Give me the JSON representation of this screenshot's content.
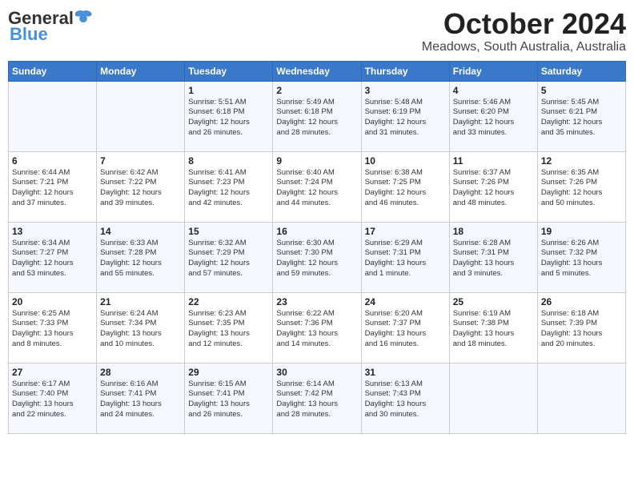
{
  "header": {
    "logo_general": "General",
    "logo_blue": "Blue",
    "month": "October 2024",
    "location": "Meadows, South Australia, Australia"
  },
  "weekdays": [
    "Sunday",
    "Monday",
    "Tuesday",
    "Wednesday",
    "Thursday",
    "Friday",
    "Saturday"
  ],
  "weeks": [
    [
      {
        "day": "",
        "info": ""
      },
      {
        "day": "",
        "info": ""
      },
      {
        "day": "1",
        "info": "Sunrise: 5:51 AM\nSunset: 6:18 PM\nDaylight: 12 hours\nand 26 minutes."
      },
      {
        "day": "2",
        "info": "Sunrise: 5:49 AM\nSunset: 6:18 PM\nDaylight: 12 hours\nand 28 minutes."
      },
      {
        "day": "3",
        "info": "Sunrise: 5:48 AM\nSunset: 6:19 PM\nDaylight: 12 hours\nand 31 minutes."
      },
      {
        "day": "4",
        "info": "Sunrise: 5:46 AM\nSunset: 6:20 PM\nDaylight: 12 hours\nand 33 minutes."
      },
      {
        "day": "5",
        "info": "Sunrise: 5:45 AM\nSunset: 6:21 PM\nDaylight: 12 hours\nand 35 minutes."
      }
    ],
    [
      {
        "day": "6",
        "info": "Sunrise: 6:44 AM\nSunset: 7:21 PM\nDaylight: 12 hours\nand 37 minutes."
      },
      {
        "day": "7",
        "info": "Sunrise: 6:42 AM\nSunset: 7:22 PM\nDaylight: 12 hours\nand 39 minutes."
      },
      {
        "day": "8",
        "info": "Sunrise: 6:41 AM\nSunset: 7:23 PM\nDaylight: 12 hours\nand 42 minutes."
      },
      {
        "day": "9",
        "info": "Sunrise: 6:40 AM\nSunset: 7:24 PM\nDaylight: 12 hours\nand 44 minutes."
      },
      {
        "day": "10",
        "info": "Sunrise: 6:38 AM\nSunset: 7:25 PM\nDaylight: 12 hours\nand 46 minutes."
      },
      {
        "day": "11",
        "info": "Sunrise: 6:37 AM\nSunset: 7:26 PM\nDaylight: 12 hours\nand 48 minutes."
      },
      {
        "day": "12",
        "info": "Sunrise: 6:35 AM\nSunset: 7:26 PM\nDaylight: 12 hours\nand 50 minutes."
      }
    ],
    [
      {
        "day": "13",
        "info": "Sunrise: 6:34 AM\nSunset: 7:27 PM\nDaylight: 12 hours\nand 53 minutes."
      },
      {
        "day": "14",
        "info": "Sunrise: 6:33 AM\nSunset: 7:28 PM\nDaylight: 12 hours\nand 55 minutes."
      },
      {
        "day": "15",
        "info": "Sunrise: 6:32 AM\nSunset: 7:29 PM\nDaylight: 12 hours\nand 57 minutes."
      },
      {
        "day": "16",
        "info": "Sunrise: 6:30 AM\nSunset: 7:30 PM\nDaylight: 12 hours\nand 59 minutes."
      },
      {
        "day": "17",
        "info": "Sunrise: 6:29 AM\nSunset: 7:31 PM\nDaylight: 13 hours\nand 1 minute."
      },
      {
        "day": "18",
        "info": "Sunrise: 6:28 AM\nSunset: 7:31 PM\nDaylight: 13 hours\nand 3 minutes."
      },
      {
        "day": "19",
        "info": "Sunrise: 6:26 AM\nSunset: 7:32 PM\nDaylight: 13 hours\nand 5 minutes."
      }
    ],
    [
      {
        "day": "20",
        "info": "Sunrise: 6:25 AM\nSunset: 7:33 PM\nDaylight: 13 hours\nand 8 minutes."
      },
      {
        "day": "21",
        "info": "Sunrise: 6:24 AM\nSunset: 7:34 PM\nDaylight: 13 hours\nand 10 minutes."
      },
      {
        "day": "22",
        "info": "Sunrise: 6:23 AM\nSunset: 7:35 PM\nDaylight: 13 hours\nand 12 minutes."
      },
      {
        "day": "23",
        "info": "Sunrise: 6:22 AM\nSunset: 7:36 PM\nDaylight: 13 hours\nand 14 minutes."
      },
      {
        "day": "24",
        "info": "Sunrise: 6:20 AM\nSunset: 7:37 PM\nDaylight: 13 hours\nand 16 minutes."
      },
      {
        "day": "25",
        "info": "Sunrise: 6:19 AM\nSunset: 7:38 PM\nDaylight: 13 hours\nand 18 minutes."
      },
      {
        "day": "26",
        "info": "Sunrise: 6:18 AM\nSunset: 7:39 PM\nDaylight: 13 hours\nand 20 minutes."
      }
    ],
    [
      {
        "day": "27",
        "info": "Sunrise: 6:17 AM\nSunset: 7:40 PM\nDaylight: 13 hours\nand 22 minutes."
      },
      {
        "day": "28",
        "info": "Sunrise: 6:16 AM\nSunset: 7:41 PM\nDaylight: 13 hours\nand 24 minutes."
      },
      {
        "day": "29",
        "info": "Sunrise: 6:15 AM\nSunset: 7:41 PM\nDaylight: 13 hours\nand 26 minutes."
      },
      {
        "day": "30",
        "info": "Sunrise: 6:14 AM\nSunset: 7:42 PM\nDaylight: 13 hours\nand 28 minutes."
      },
      {
        "day": "31",
        "info": "Sunrise: 6:13 AM\nSunset: 7:43 PM\nDaylight: 13 hours\nand 30 minutes."
      },
      {
        "day": "",
        "info": ""
      },
      {
        "day": "",
        "info": ""
      }
    ]
  ]
}
